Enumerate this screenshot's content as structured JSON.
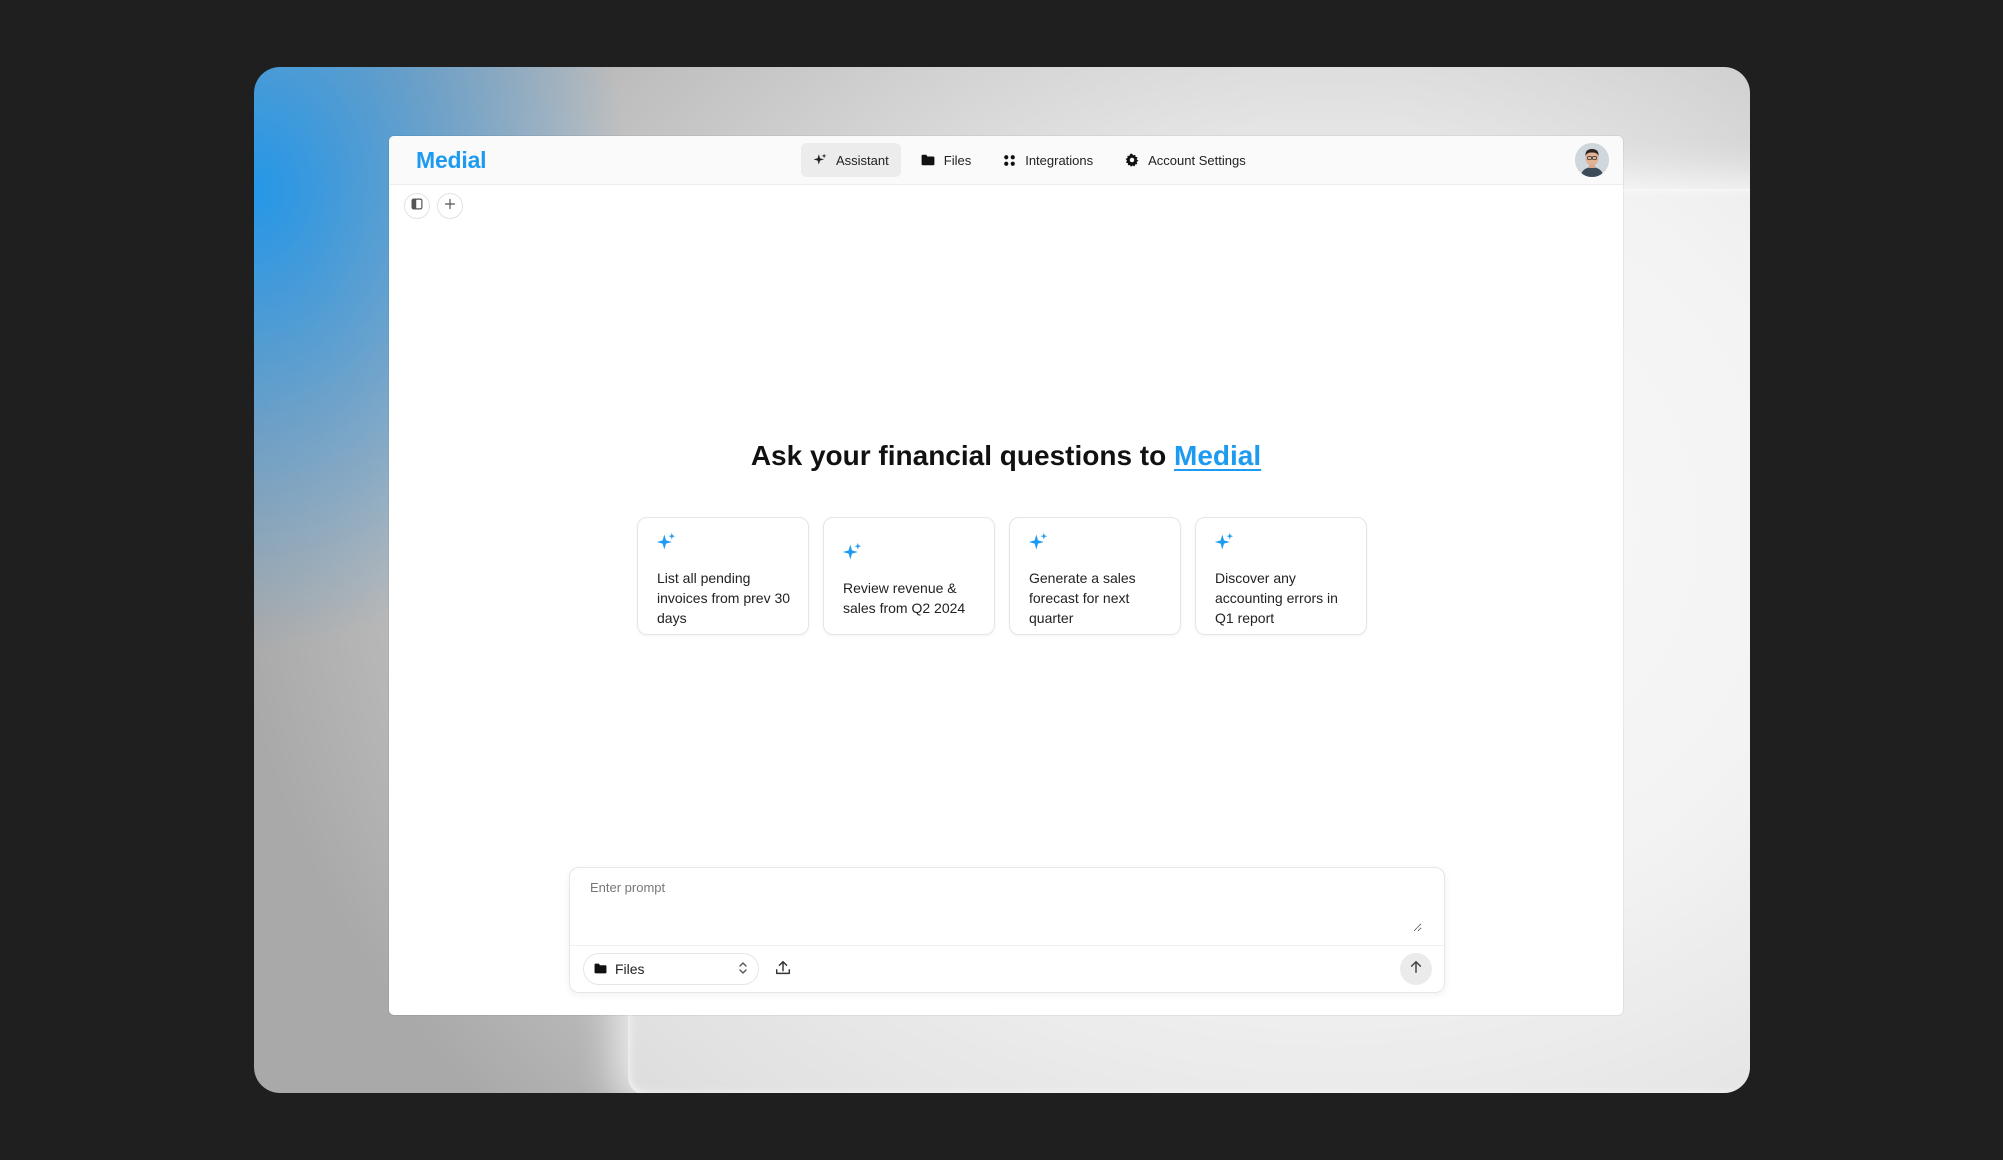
{
  "brand": {
    "name": "Medial",
    "accent_color": "#1d9bf0"
  },
  "nav": [
    {
      "label": "Assistant",
      "icon": "sparkle-icon",
      "active": true
    },
    {
      "label": "Files",
      "icon": "folder-icon",
      "active": false
    },
    {
      "label": "Integrations",
      "icon": "grid-icon",
      "active": false
    },
    {
      "label": "Account Settings",
      "icon": "gear-icon",
      "active": false
    }
  ],
  "toolbar": {
    "sidebar_toggle_icon": "sidebar-toggle-icon",
    "new_chat_icon": "plus-icon"
  },
  "headline": {
    "prefix": "Ask your financial questions to ",
    "accent": "Medial"
  },
  "suggestions": [
    {
      "text": "List all pending invoices from prev 30 days",
      "icon": "sparkle-icon"
    },
    {
      "text": "Review revenue & sales from Q2 2024",
      "icon": "sparkle-icon"
    },
    {
      "text": "Generate a sales forecast for next quarter",
      "icon": "sparkle-icon"
    },
    {
      "text": "Discover any accounting errors in Q1 report",
      "icon": "sparkle-icon"
    }
  ],
  "prompt": {
    "placeholder": "Enter prompt",
    "value": "",
    "source_select": {
      "selected": "Files",
      "icon": "folder-icon"
    },
    "upload_icon": "upload-icon",
    "send_icon": "arrow-up-icon"
  }
}
